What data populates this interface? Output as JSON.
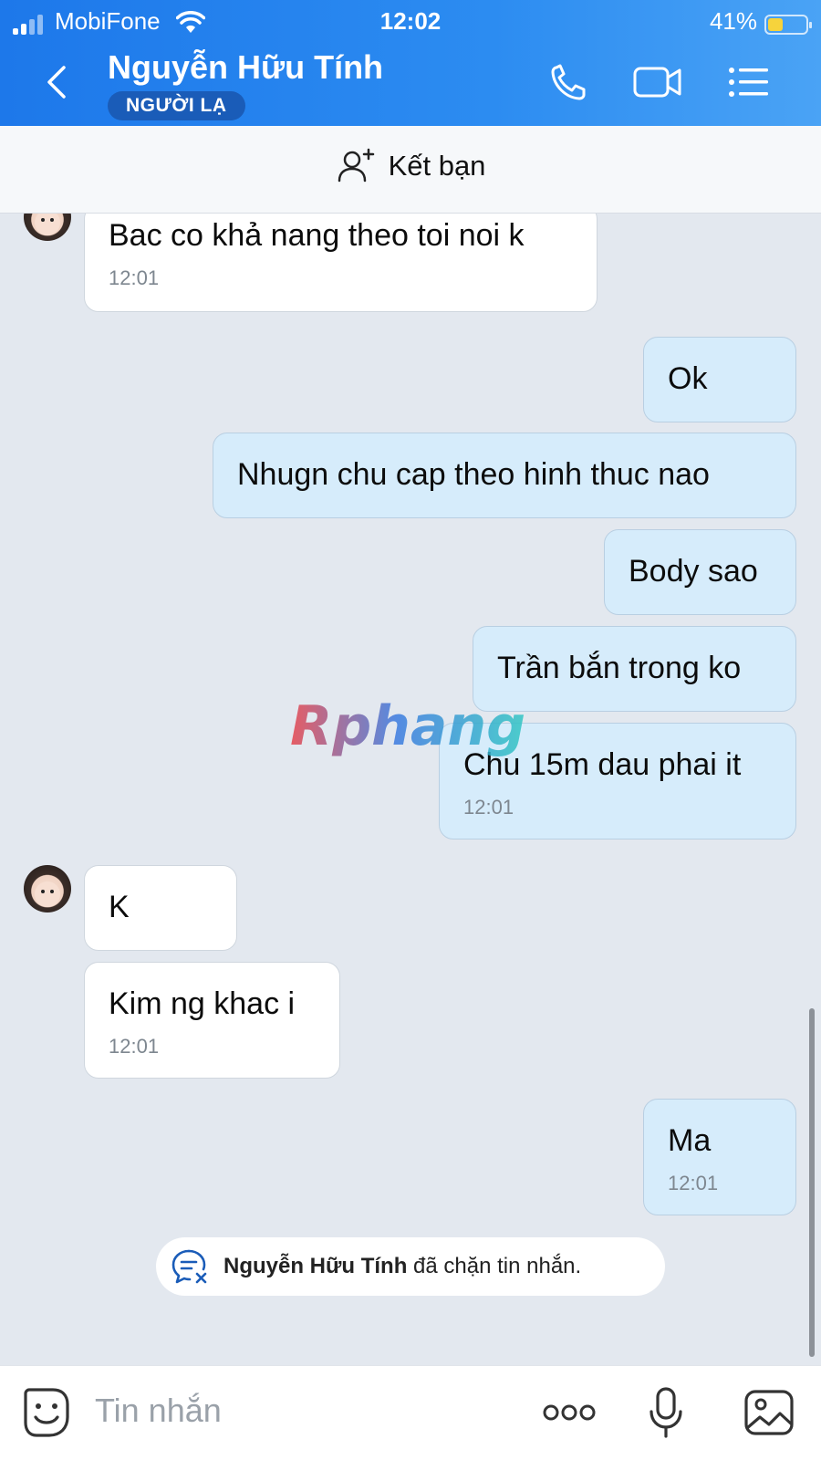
{
  "status_bar": {
    "carrier": "MobiFone",
    "time": "12:02",
    "battery_percent": "41%",
    "battery_level": 0.41
  },
  "header": {
    "contact_name": "Nguyễn Hữu Tính",
    "badge": "NGƯỜI LẠ",
    "icons": [
      "back-chevron-icon",
      "phone-icon",
      "video-call-icon",
      "menu-list-icon"
    ],
    "background_color": "#2c8cf1"
  },
  "add_friend": {
    "label": "Kết bạn",
    "icon": "add-person-icon"
  },
  "messages": [
    {
      "side": "in",
      "text": "Bac co khả nang theo toi noi k",
      "time": "12:01"
    },
    {
      "side": "out",
      "text": "Ok"
    },
    {
      "side": "out",
      "text": "Nhugn chu cap theo hinh thuc nao"
    },
    {
      "side": "out",
      "text": "Body sao"
    },
    {
      "side": "out",
      "text": "Trần bắn trong ko"
    },
    {
      "side": "out",
      "text": "Chu 15m dau phai it",
      "time": "12:01"
    },
    {
      "side": "in",
      "text": "K"
    },
    {
      "side": "in",
      "text": "Kim ng khac i",
      "time": "12:01"
    },
    {
      "side": "out",
      "text": "Ma",
      "time": "12:01"
    }
  ],
  "system_notice": {
    "name": "Nguyễn Hữu Tính",
    "text": " đã chặn tin nhắn.",
    "icon": "blocked-chat-icon"
  },
  "watermark": "Rphang",
  "input_bar": {
    "placeholder": "Tin nhắn",
    "icons": [
      "emoji-sticker-icon",
      "more-dots-icon",
      "microphone-icon",
      "image-icon"
    ]
  },
  "colors": {
    "outgoing_bubble": "#d6ecfb",
    "incoming_bubble": "#ffffff",
    "chat_background": "#e3e8ef",
    "badge": "#1a5cb8"
  }
}
